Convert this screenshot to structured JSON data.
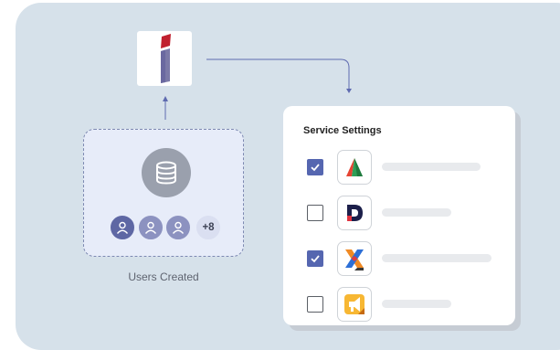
{
  "users_box": {
    "caption": "Users Created",
    "extra_count": "+8"
  },
  "service_settings": {
    "title": "Service Settings",
    "services": [
      {
        "checked": true,
        "icon": "a-triangle-logo-icon"
      },
      {
        "checked": false,
        "icon": "d-logo-icon"
      },
      {
        "checked": true,
        "icon": "x-logo-icon"
      },
      {
        "checked": false,
        "icon": "megaphone-logo-icon"
      }
    ]
  },
  "colors": {
    "canvas": "#d6e1ea",
    "accent": "#5566b0",
    "checkbox": "#5566b0",
    "dashed_border": "#7d89b1"
  }
}
